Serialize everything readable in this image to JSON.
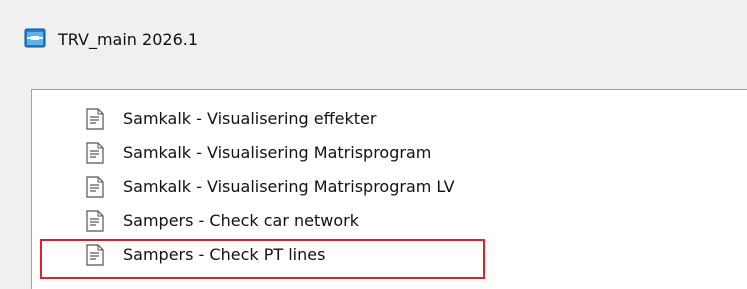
{
  "window": {
    "title": "TRV_main 2026.1",
    "icon": "app-window-icon"
  },
  "list": {
    "items": [
      {
        "label": "Samkalk - Visualisering effekter",
        "icon": "document-icon"
      },
      {
        "label": "Samkalk - Visualisering Matrisprogram",
        "icon": "document-icon"
      },
      {
        "label": "Samkalk - Visualisering Matrisprogram LV",
        "icon": "document-icon"
      },
      {
        "label": "Sampers - Check car network",
        "icon": "document-icon"
      },
      {
        "label": "Sampers - Check PT lines",
        "icon": "document-icon",
        "highlighted": true
      }
    ]
  },
  "colors": {
    "highlight_border": "#e0202a",
    "title_icon": "#1e7fd0"
  }
}
